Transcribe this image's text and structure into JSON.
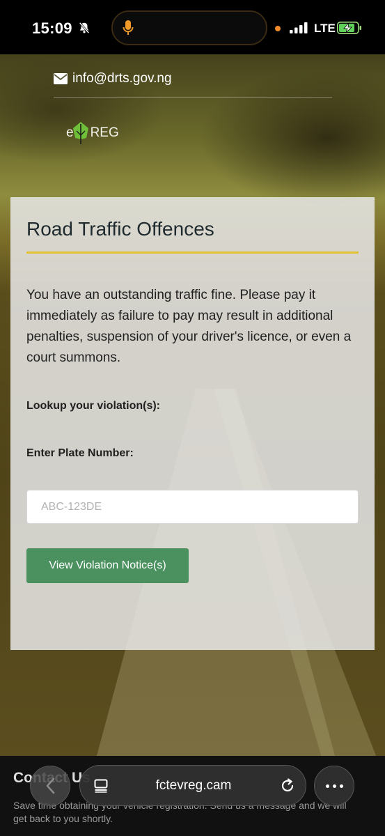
{
  "status_bar": {
    "time": "15:09",
    "network": "LTE",
    "icons": [
      "bell-slash-icon",
      "microphone-icon",
      "signal-icon",
      "battery-charging-icon"
    ]
  },
  "header": {
    "email": "info@drts.gov.ng",
    "logo_text_left": "e",
    "logo_text_right": "REG"
  },
  "card": {
    "title": "Road Traffic Offences",
    "message": "You have an outstanding traffic fine. Please pay it immediately as failure to pay may result in additional penalties, suspension of your driver's licence, or even a court summons.",
    "lookup_label": "Lookup your violation(s):",
    "plate_label": "Enter Plate Number:",
    "plate_placeholder": "ABC-123DE",
    "plate_value": "",
    "button_label": "View Violation Notice(s)"
  },
  "footer": {
    "contact_title": "Contact Us",
    "contact_text_line1": "Save time obtaining your vehicle registration. Send us a message and we will",
    "contact_text_line2": "get back to you shortly."
  },
  "browser": {
    "url": "fctevreg.cam"
  },
  "colors": {
    "accent_rule": "#e0c232",
    "button_green": "#4b9160"
  }
}
